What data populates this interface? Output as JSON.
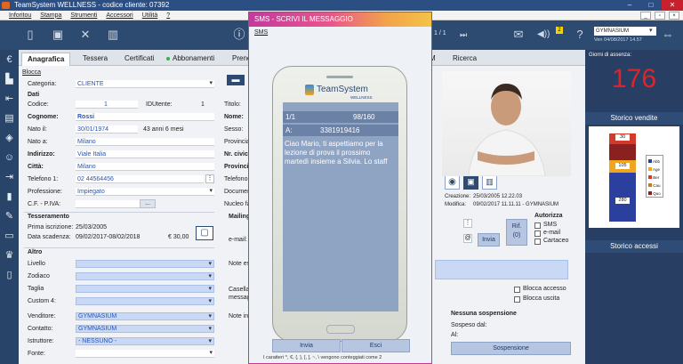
{
  "window": {
    "title": "TeamSystem WELLNESS - codice cliente:  07392",
    "min": "–",
    "max": "□",
    "close": "✕"
  },
  "menu": [
    "Inforitou",
    "Stampa",
    "Strumenti",
    "Accessori",
    "Utilità",
    "?"
  ],
  "toolbar": {
    "info": "ⓘ",
    "pager": "1 / 1",
    "notif_count": "2",
    "gym": "GYMNASIUM",
    "gym_date": "Ven 04/08/2017 14.57"
  },
  "tabs": {
    "anagrafica": "Anagrafica",
    "tessera": "Tessera",
    "certificati": "Certificati",
    "abbonamenti": "Abbonamenti",
    "prenotazioni": "Preno",
    "m": "M",
    "ricerca": "Ricerca"
  },
  "form": {
    "blocca": "Blocca",
    "categoria_l": "Categoria:",
    "categoria": "CLIENTE",
    "dati": "Dati",
    "codice_l": "Codice:",
    "codice": "1",
    "idutente_l": "IDUtente:",
    "idutente": "1",
    "cognome_l": "Cognome:",
    "cognome": "Rossi",
    "nato_il_l": "Nato il:",
    "nato_il": "30/01/1974",
    "eta": "43 anni 6 mesi",
    "nato_a_l": "Nato a:",
    "nato_a": "Milano",
    "indirizzo_l": "Indirizzo:",
    "indirizzo": "Viale Italia",
    "citta_l": "Città:",
    "citta": "Milano",
    "telefono_l": "Telefono 1:",
    "telefono": "02 44564456",
    "professione_l": "Professione:",
    "professione": "Impiegato",
    "cf_l": "C.F. - P.IVA:",
    "cf_btn": "...",
    "tesseramento": "Tesseramento",
    "prima_l": "Prima iscrizione:",
    "prima": "25/03/2005",
    "scad_l": "Data scadenza:",
    "scad": "09/02/2017-08/02/2018",
    "importo": "€ 30,00",
    "altro": "Altro",
    "livello_l": "Livello",
    "zodiaco_l": "Zodiaco",
    "taglia_l": "Taglia",
    "custom_l": "Custom 4:",
    "venditore_l": "Venditore:",
    "venditore": "GYMNASIUM",
    "contatto_l": "Contatto:",
    "contatto": "GYMNASIUM",
    "istruttore_l": "Istruttore:",
    "istruttore": "- NESSUNO -",
    "fonte_l": "Fonte:"
  },
  "middle": {
    "titolo": "Titolo:",
    "nome": "Nome:",
    "sesso": "Sesso:",
    "provincia": "Provincia",
    "nr_civico": "Nr. civico",
    "provincia2": "Provincia",
    "telefono2": "Telefono",
    "documento": "Document",
    "nucleo": "Nucleo fa",
    "mailing": "Mailing",
    "email": "e-mail:",
    "note_es": "Note es",
    "casella": "Casella",
    "messaggi": "messagg",
    "note_in": "Note in"
  },
  "right_form": {
    "creazione_l": "Creazione:",
    "creazione": "25/03/2005 12.22.03",
    "modifica_l": "Modifica:",
    "modifica": "09/02/2017 11.11.11 - GYMNASIUM",
    "autorizza": "Autorizza",
    "sms": "SMS",
    "email": "e-mail",
    "cartaceo": "Cartaceo",
    "rif": "Rif.",
    "rif0": "(0)",
    "invia": "Invia",
    "blocca_accesso": "Blocca accesso",
    "blocca_uscita": "Blocca uscita",
    "nessuna_sosp": "Nessuna sospensione",
    "sospeso_dal": "Sospeso dal:",
    "al": "Al:",
    "sospensione": "Sospensione"
  },
  "side": {
    "giorni_label": "Giorni di assenza:",
    "giorni": "176",
    "storico_vendite": "Storico vendite",
    "storico_accessi": "Storico accessi",
    "legend": [
      "Abb",
      "Age",
      "Ber",
      "Cau",
      "Quo"
    ],
    "legend_colors": [
      "#2a3f9e",
      "#f0a520",
      "#d23a2a",
      "#c47a1e",
      "#8a2020"
    ],
    "bar_labels": [
      "30",
      "105",
      "280"
    ]
  },
  "sms_dialog": {
    "title": "SMS - SCRIVI IL MESSAGGIO",
    "menu": "SMS",
    "brand": "TeamSystem",
    "brand_sub": "WELLNESS",
    "counter_left": "1/1",
    "counter_right": "98/160",
    "to_label": "A:",
    "to_number": "3381919416",
    "message": "Ciao Mario,  ti aspettiamo per la lezione di prova il prossimo martedì insieme a Silvia. Lo staff",
    "send": "Invia",
    "exit": "Esci",
    "footer": "I caratteri ^, €, {, }, [, ], ~, \\ vengono conteggiati come 2"
  },
  "colors": {
    "toolbar": "#2d4a70",
    "accent": "#c7359a",
    "bignum": "#e0232b"
  }
}
